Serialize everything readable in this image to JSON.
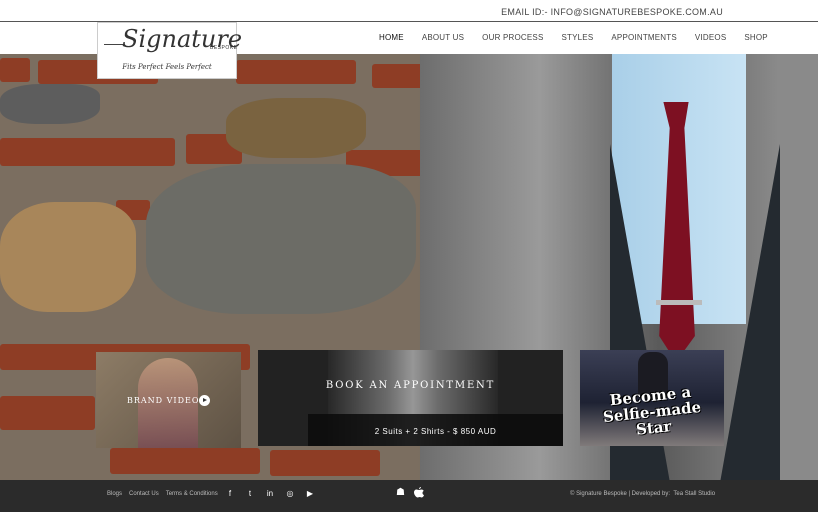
{
  "topbar": {
    "email": "EMAIL ID:- INFO@SIGNATUREBESPOKE.COM.AU"
  },
  "logo": {
    "word": "Signature",
    "sub": "BESPOKE",
    "tagline": "Fits Perfect Feels Perfect"
  },
  "nav": {
    "items": [
      "HOME",
      "ABOUT US",
      "OUR PROCESS",
      "STYLES",
      "APPOINTMENTS",
      "VIDEOS",
      "SHOP"
    ],
    "active": "HOME"
  },
  "cards": {
    "brand_video": "BRAND VIDEO",
    "book_title": "BOOK AN APPOINTMENT",
    "book_price": "2 Suits + 2 Shirts - $ 850 AUD",
    "selfie_line1": "Become a",
    "selfie_line2": "Selfie-made",
    "selfie_line3": "Star"
  },
  "footer": {
    "links": [
      "Blogs",
      "Contact Us",
      "Terms & Conditions"
    ],
    "social_icons": [
      "facebook-icon",
      "twitter-icon",
      "linkedin-icon",
      "instagram-icon",
      "youtube-icon"
    ],
    "social_glyphs": [
      "f",
      "t",
      "in",
      "◎",
      "▶"
    ],
    "app_icons": [
      "android-icon",
      "apple-icon"
    ],
    "app_glyphs": [
      "☗",
      ""
    ],
    "credit_prefix": "© Signature Bespoke | Developed by:",
    "credit_dev": "Tea Stall Studio"
  },
  "colors": {
    "footer": "#2b2b2b",
    "tie": "#7d1022",
    "brick": "#8e3d25"
  }
}
